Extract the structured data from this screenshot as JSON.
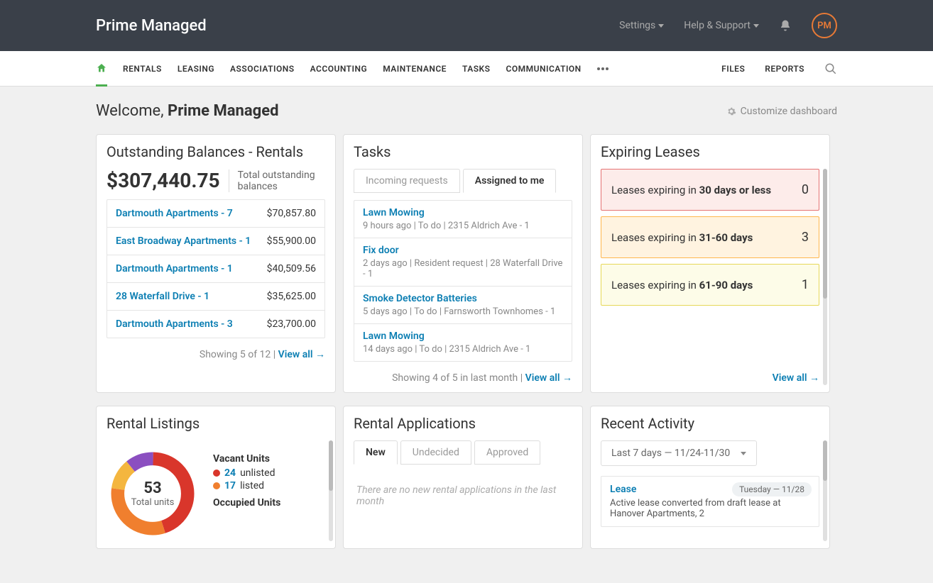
{
  "header": {
    "brand": "Prime Managed",
    "settings": "Settings",
    "help": "Help & Support",
    "avatar_initials": "PM"
  },
  "nav": {
    "items": [
      "RENTALS",
      "LEASING",
      "ASSOCIATIONS",
      "ACCOUNTING",
      "MAINTENANCE",
      "TASKS",
      "COMMUNICATION"
    ],
    "files": "FILES",
    "reports": "REPORTS"
  },
  "welcome": {
    "prefix": "Welcome, ",
    "name": "Prime Managed",
    "customize": "Customize dashboard"
  },
  "balances": {
    "title": "Outstanding Balances - Rentals",
    "total": "$307,440.75",
    "sub": "Total outstanding balances",
    "rows": [
      {
        "name": "Dartmouth Apartments - 7",
        "amt": "$70,857.80"
      },
      {
        "name": "East Broadway Apartments - 1",
        "amt": "$55,900.00"
      },
      {
        "name": "Dartmouth Apartments - 1",
        "amt": "$40,509.56"
      },
      {
        "name": "28 Waterfall Drive - 1",
        "amt": "$35,625.00"
      },
      {
        "name": "Dartmouth Apartments - 3",
        "amt": "$23,700.00"
      }
    ],
    "showing": "Showing 5 of 12  |  ",
    "view_all": "View all →"
  },
  "tasks": {
    "title": "Tasks",
    "tab_incoming": "Incoming requests",
    "tab_assigned": "Assigned to me",
    "rows": [
      {
        "name": "Lawn Mowing",
        "meta": "9 hours ago | To do | 2315 Aldrich Ave - 1"
      },
      {
        "name": "Fix door",
        "meta": "2 days ago | Resident request | 28 Waterfall Drive - 1"
      },
      {
        "name": "Smoke Detector Batteries",
        "meta": "5 days ago | To do | Farnsworth Townhomes - 1"
      },
      {
        "name": "Lawn Mowing",
        "meta": "14 days ago | To do | 2315 Aldrich Ave - 1"
      }
    ],
    "showing": "Showing 4 of 5 in last month  |  ",
    "view_all": "View all →"
  },
  "leases": {
    "title": "Expiring Leases",
    "rows": [
      {
        "prefix": "Leases expiring in ",
        "range": "30 days or less",
        "count": "0"
      },
      {
        "prefix": "Leases expiring in ",
        "range": "31-60 days",
        "count": "3"
      },
      {
        "prefix": "Leases expiring in ",
        "range": "61-90 days",
        "count": "1"
      }
    ],
    "view_all": "View all →"
  },
  "listings": {
    "title": "Rental Listings",
    "total": "53",
    "total_label": "Total units",
    "vacant_h": "Vacant Units",
    "unlisted_n": "24",
    "unlisted_l": "unlisted",
    "listed_n": "17",
    "listed_l": "listed",
    "occupied_h": "Occupied Units"
  },
  "apps": {
    "title": "Rental Applications",
    "tab_new": "New",
    "tab_undecided": "Undecided",
    "tab_approved": "Approved",
    "empty": "There are no new rental applications in the last month"
  },
  "activity": {
    "title": "Recent Activity",
    "range": "Last 7 days — 11/24-11/30",
    "item": {
      "badge": "Tuesday — 11/28",
      "name": "Lease",
      "desc": "Active lease converted from draft lease at Hanover Apartments, 2"
    }
  },
  "chart_data": {
    "type": "pie",
    "title": "Rental Listings",
    "series": [
      {
        "name": "Unlisted vacant",
        "value": 24,
        "color": "#d9362b"
      },
      {
        "name": "Listed vacant",
        "value": 17,
        "color": "#f07f2e"
      },
      {
        "name": "Occupied (segment A)",
        "value": 6,
        "color": "#f4b63f"
      },
      {
        "name": "Occupied (segment B)",
        "value": 6,
        "color": "#8b4fc0"
      }
    ],
    "center_value": 53,
    "center_label": "Total units"
  }
}
